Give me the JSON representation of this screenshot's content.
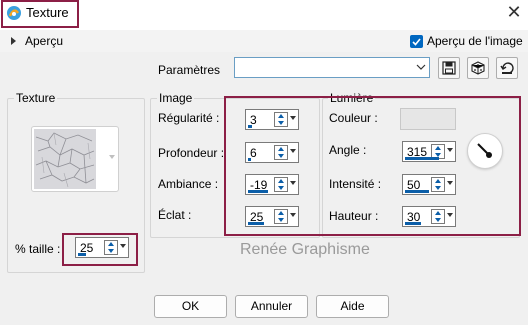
{
  "window": {
    "title": "Texture",
    "close_label": "✕"
  },
  "apercu": {
    "label": "Aperçu",
    "checkbox_label": "Aperçu de l'image",
    "checked": true
  },
  "params": {
    "label": "Paramètres",
    "preset_value": ""
  },
  "texture_group": {
    "label": "Texture",
    "size_label": "% taille :",
    "size_value": "25"
  },
  "image_group": {
    "label": "Image",
    "fields": [
      {
        "label": "Régularité :",
        "value": "3"
      },
      {
        "label": "Profondeur :",
        "value": "6"
      },
      {
        "label": "Ambiance :",
        "value": "-19"
      },
      {
        "label": "Éclat :",
        "value": "25"
      }
    ]
  },
  "lumiere_group": {
    "label": "Lumière",
    "color_label": "Couleur :",
    "color_value": "#e6e6e6",
    "fields": [
      {
        "label": "Angle :",
        "value": "315"
      },
      {
        "label": "Intensité :",
        "value": "50"
      },
      {
        "label": "Hauteur :",
        "value": "30"
      }
    ]
  },
  "watermark": "Renée Graphisme",
  "buttons": {
    "ok": "OK",
    "cancel": "Annuler",
    "help": "Aide"
  },
  "colors": {
    "accent": "#0067c0",
    "highlight": "#8c1f46",
    "spin_blue": "#0b5ea8"
  }
}
